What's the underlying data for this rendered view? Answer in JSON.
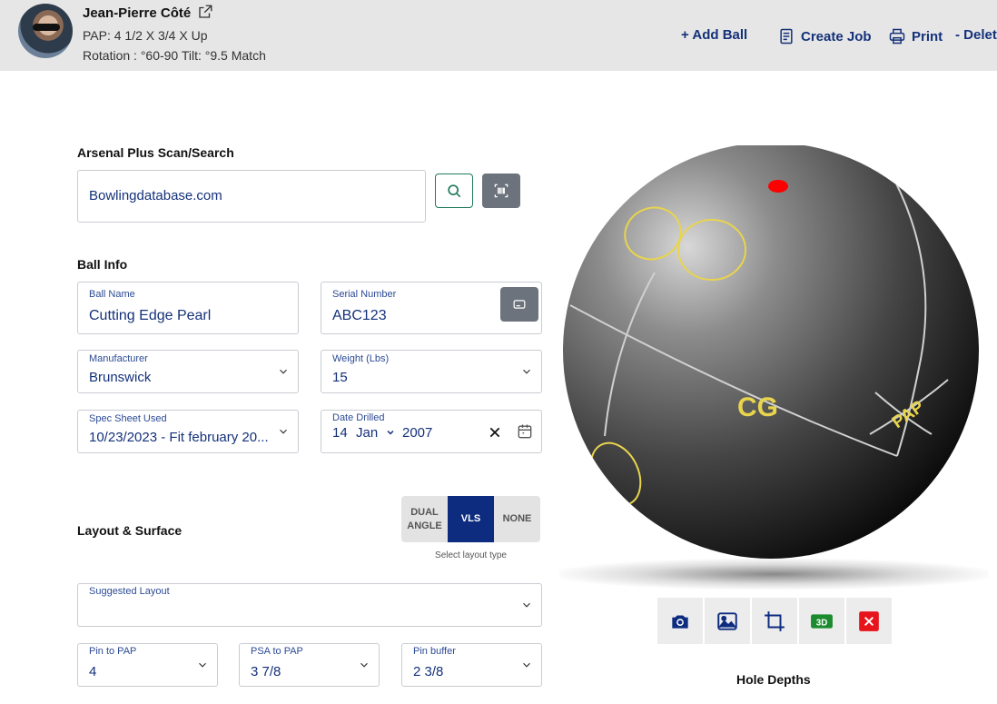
{
  "header": {
    "user_name": "Jean-Pierre Côté",
    "pap": "PAP: 4 1/2 X 3/4 X Up",
    "rotation": "Rotation : °60-90 Tilt: °9.5 Match",
    "actions": {
      "add_ball": "+ Add Ball",
      "create_job": "Create Job",
      "print": "Print",
      "delete": "- Delete"
    }
  },
  "search": {
    "title": "Arsenal Plus Scan/Search",
    "value": "Bowlingdatabase.com"
  },
  "ball_info": {
    "title": "Ball Info",
    "ball_name": {
      "label": "Ball Name",
      "value": "Cutting Edge Pearl"
    },
    "serial_number": {
      "label": "Serial Number",
      "value": "ABC123"
    },
    "manufacturer": {
      "label": "Manufacturer",
      "value": "Brunswick"
    },
    "weight": {
      "label": "Weight (Lbs)",
      "value": "15"
    },
    "spec_sheet": {
      "label": "Spec Sheet Used",
      "value": "10/23/2023 - Fit february 20..."
    },
    "date_drilled": {
      "label": "Date Drilled",
      "day": "14",
      "month": "Jan",
      "year": "2007"
    }
  },
  "layout": {
    "title": "Layout & Surface",
    "options": [
      {
        "label": "DUAL ANGLE",
        "active": false
      },
      {
        "label": "VLS",
        "active": true
      },
      {
        "label": "NONE",
        "active": false
      }
    ],
    "caption": "Select layout type",
    "suggested_layout": {
      "label": "Suggested Layout",
      "value": ""
    },
    "pin_to_pap": {
      "label": "Pin to PAP",
      "value": "4"
    },
    "psa_to_pap": {
      "label": "PSA to PAP",
      "value": "3 7/8"
    },
    "pin_buffer": {
      "label": "Pin buffer",
      "value": "2 3/8"
    }
  },
  "ball_view": {
    "cg_label": "CG",
    "pap_label": "PAP",
    "tools": [
      {
        "name": "camera-icon"
      },
      {
        "name": "image-icon"
      },
      {
        "name": "crop-icon"
      },
      {
        "name": "3d-icon",
        "label": "3D"
      },
      {
        "name": "close-icon"
      }
    ]
  },
  "hole_depths": {
    "title": "Hole Depths"
  },
  "colors": {
    "accent": "#14317a",
    "toggle_active": "#0d2c80",
    "search_btn_border": "#1f7a5c",
    "barcode_btn": "#6c737c",
    "marker_yellow": "#e8d44d",
    "pin_red": "#ff0000",
    "tool_3d": "#1c8a2e",
    "tool_close": "#e8141b"
  }
}
